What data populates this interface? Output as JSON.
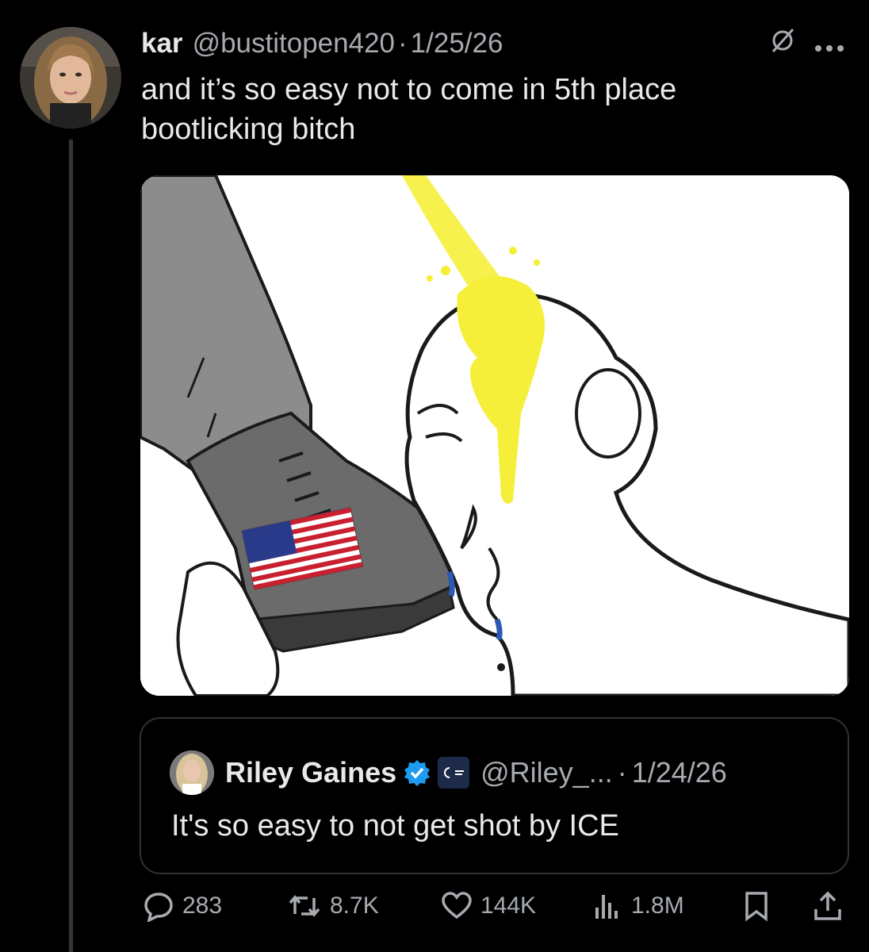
{
  "post": {
    "author_name": "kar",
    "author_handle": "@bustitopen420",
    "separator": "·",
    "date": "1/25/26",
    "text_line1": "and it’s so easy not to come in 5th place",
    "text_line2": "bootlicking bitch",
    "header_icons": [
      "grok-slash-icon",
      "more-dots-icon"
    ]
  },
  "quote": {
    "author_name": "Riley Gaines",
    "verified_icon": "verified-badge-icon",
    "affiliate_icon": "affiliate-badge-icon",
    "author_handle": "@Riley_...",
    "separator": "·",
    "date": "1/24/26",
    "text": "It's so easy to not get shot by ICE"
  },
  "actions": {
    "replies": "283",
    "reposts": "8.7K",
    "likes": "144K",
    "views": "1.8M"
  },
  "colors": {
    "background": "#000000",
    "text_primary": "#e7e9ea",
    "text_secondary": "#a7abb0",
    "verified": "#1d9bf0",
    "thread_line": "#333639"
  }
}
